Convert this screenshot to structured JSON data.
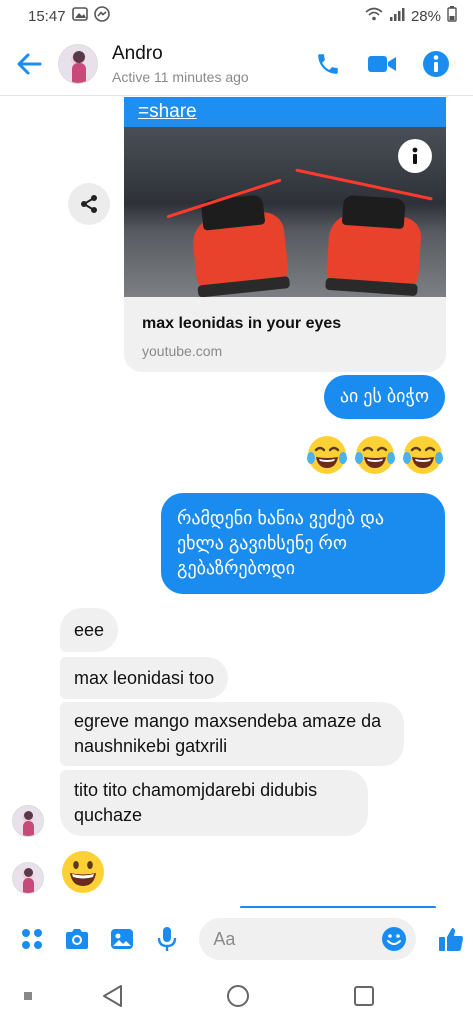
{
  "status_bar": {
    "time": "15:47",
    "battery": "28%"
  },
  "header": {
    "contact_name": "Andro",
    "contact_status": "Active 11 minutes ago",
    "accent": "#1a8cf0"
  },
  "link_preview": {
    "url_text": "=share",
    "title": "max leonidas in your eyes",
    "domain": "youtube.com"
  },
  "messages_out": [
    "აი ეს ბიჭო",
    "რამდენი ხანია ვეძებ და ეხლა გავიხსენე რო გებაზრებოდი"
  ],
  "emoji_reactions": [
    "😂",
    "😂",
    "😂"
  ],
  "messages_in": [
    "eee",
    "max leonidasi too",
    "egreve mango maxsendeba amaze da naushnikebi gatxrili",
    "tito tito chamomjdarebi didubis quchaze"
  ],
  "last_emoji": "😀",
  "composer": {
    "placeholder": "Aa"
  }
}
